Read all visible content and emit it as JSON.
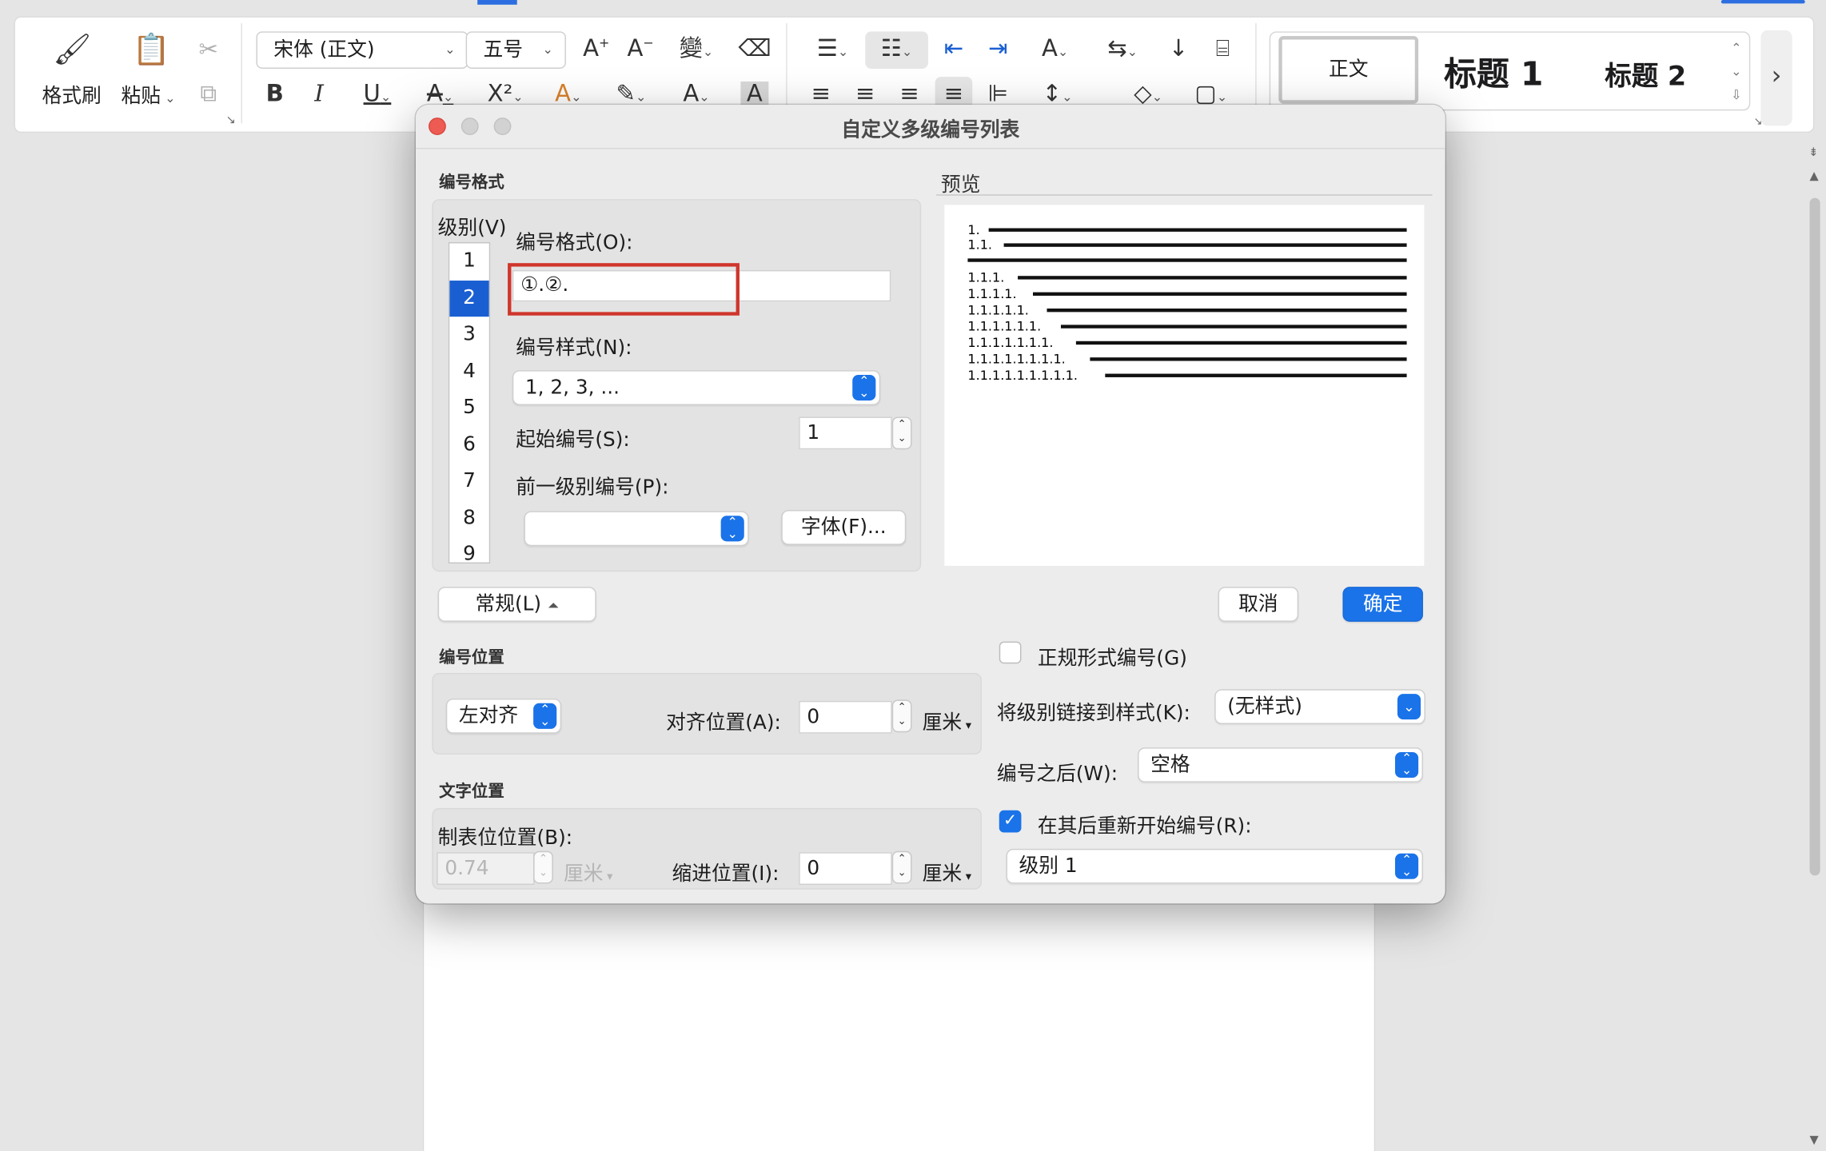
{
  "ribbon": {
    "format_painter_label": "格式刷",
    "paste_label": "粘贴",
    "font_name": "宋体 (正文)",
    "font_size": "五号",
    "styles": {
      "normal": "正文",
      "heading1": "标题 1",
      "heading2": "标题 2"
    }
  },
  "dialog": {
    "title": "自定义多级编号列表",
    "number_format_section": "编号格式",
    "level_label": "级别(V)",
    "levels": [
      "1",
      "2",
      "3",
      "4",
      "5",
      "6",
      "7",
      "8",
      "9"
    ],
    "selected_level": "2",
    "format_label": "编号格式(O):",
    "format_value": "①.②.",
    "style_label": "编号样式(N):",
    "style_value": "1, 2, 3, ...",
    "start_label": "起始编号(S):",
    "start_value": "1",
    "prev_level_label": "前一级别编号(P):",
    "prev_level_value": "",
    "font_button": "字体(F)...",
    "preview_label": "预览",
    "preview_rows": [
      "1.",
      "1.1.",
      "1.1.1.",
      "1.1.1.1.",
      "1.1.1.1.1.",
      "1.1.1.1.1.1.",
      "1.1.1.1.1.1.1.",
      "1.1.1.1.1.1.1.1.",
      "1.1.1.1.1.1.1.1.1."
    ],
    "general_button": "常规(L)",
    "cancel_button": "取消",
    "ok_button": "确定",
    "number_position_section": "编号位置",
    "alignment_value": "左对齐",
    "align_at_label": "对齐位置(A):",
    "align_at_value": "0",
    "unit_cm": "厘米",
    "text_position_section": "文字位置",
    "tab_stop_label": "制表位位置(B):",
    "tab_stop_value": "0.74",
    "indent_label": "缩进位置(I):",
    "indent_value": "0",
    "legal_numbering_label": "正规形式编号(G)",
    "legal_numbering_checked": false,
    "link_style_label": "将级别链接到样式(K):",
    "link_style_value": "(无样式)",
    "follow_number_label": "编号之后(W):",
    "follow_number_value": "空格",
    "restart_label": "在其后重新开始编号(R):",
    "restart_checked": true,
    "restart_value": "级别 1"
  }
}
